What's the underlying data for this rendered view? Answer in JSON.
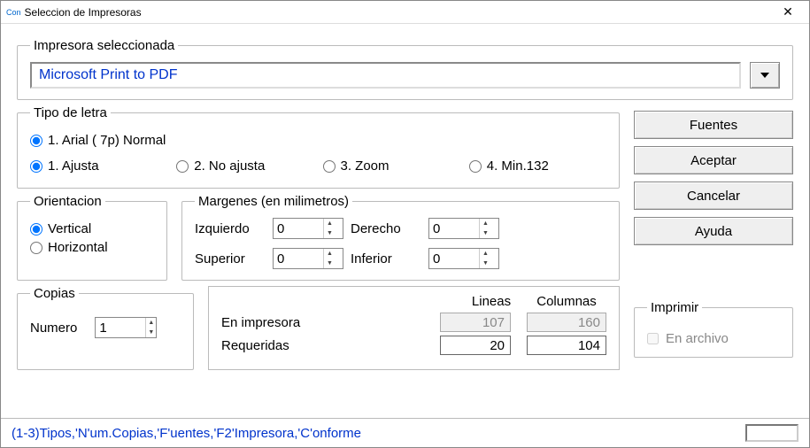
{
  "window": {
    "title": "Seleccion de Impresoras",
    "app_badge": "Con"
  },
  "printer": {
    "legend": "Impresora seleccionada",
    "name": "Microsoft Print to PDF"
  },
  "font_group": {
    "legend": "Tipo de letra",
    "main_option": "1. Arial ( 7p) Normal",
    "fit_options": [
      "1. Ajusta",
      "2. No ajusta",
      "3. Zoom",
      "4. Min.132"
    ],
    "selected_fit": 0
  },
  "orientation": {
    "legend": "Orientacion",
    "options": [
      "Vertical",
      "Horizontal"
    ],
    "selected": 0
  },
  "margins": {
    "legend": "Margenes (en milimetros)",
    "labels": {
      "left": "Izquierdo",
      "right": "Derecho",
      "top": "Superior",
      "bottom": "Inferior"
    },
    "values": {
      "left": "0",
      "right": "0",
      "top": "0",
      "bottom": "0"
    }
  },
  "copies": {
    "legend": "Copias",
    "label": "Numero",
    "value": "1"
  },
  "lines_cols": {
    "head_lines": "Lineas",
    "head_cols": "Columnas",
    "row_printer": "En impresora",
    "row_required": "Requeridas",
    "printer_lines": "107",
    "printer_cols": "160",
    "required_lines": "20",
    "required_cols": "104"
  },
  "print_group": {
    "legend": "Imprimir",
    "to_file": "En archivo"
  },
  "buttons": {
    "fonts": "Fuentes",
    "ok": "Aceptar",
    "cancel": "Cancelar",
    "help": "Ayuda"
  },
  "status": "(1-3)Tipos,'N'um.Copias,'F'uentes,'F2'Impresora,'C'onforme"
}
